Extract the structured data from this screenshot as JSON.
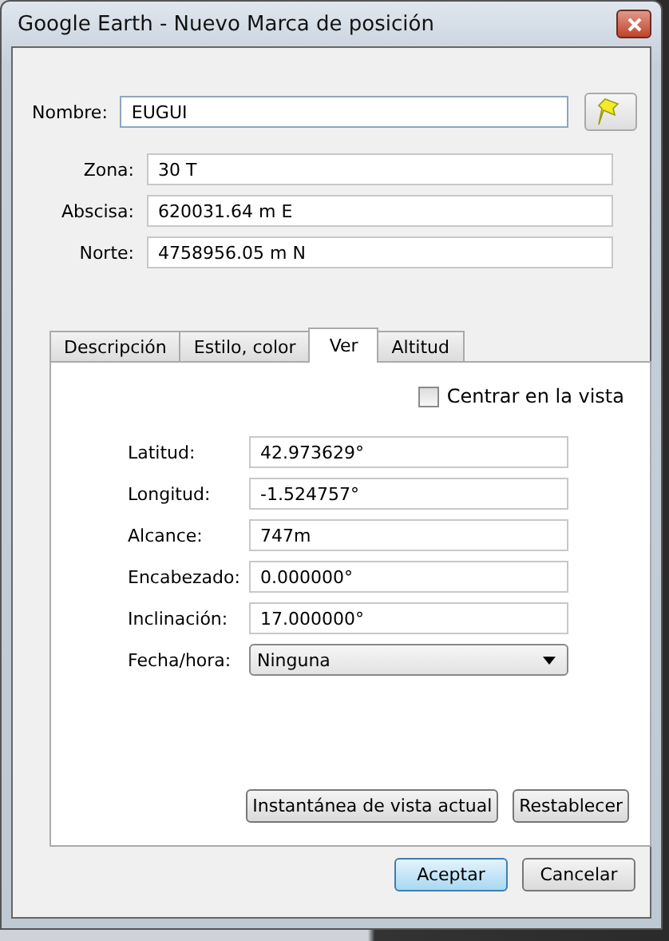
{
  "window": {
    "title": "Google Earth - Nuevo Marca de posición"
  },
  "name_field": {
    "label": "Nombre:",
    "value": "EUGUI"
  },
  "coordinates": [
    {
      "label": "Zona:",
      "value": "30 T"
    },
    {
      "label": "Abscisa:",
      "value": "620031.64 m E"
    },
    {
      "label": "Norte:",
      "value": "4758956.05 m N"
    }
  ],
  "tabs": [
    {
      "label": "Descripción",
      "selected": false
    },
    {
      "label": "Estilo, color",
      "selected": false
    },
    {
      "label": "Ver",
      "selected": true
    },
    {
      "label": "Altitud",
      "selected": false
    }
  ],
  "center_checkbox": {
    "label": "Centrar en la vista",
    "checked": false
  },
  "view_fields": [
    {
      "kind": "text",
      "label": "Latitud:",
      "value": "42.973629°"
    },
    {
      "kind": "text",
      "label": "Longitud:",
      "value": "-1.524757°"
    },
    {
      "kind": "text",
      "label": "Alcance:",
      "value": "747m"
    },
    {
      "kind": "text",
      "label": "Encabezado:",
      "value": "0.000000°"
    },
    {
      "kind": "text",
      "label": "Inclinación:",
      "value": "17.000000°"
    },
    {
      "kind": "dropdown",
      "label": "Fecha/hora:",
      "value": "Ninguna"
    }
  ],
  "panel_buttons": [
    "Instantánea de vista actual",
    "Restablecer"
  ],
  "dialog_buttons": [
    {
      "label": "Aceptar",
      "default": true
    },
    {
      "label": "Cancelar",
      "default": false
    }
  ]
}
